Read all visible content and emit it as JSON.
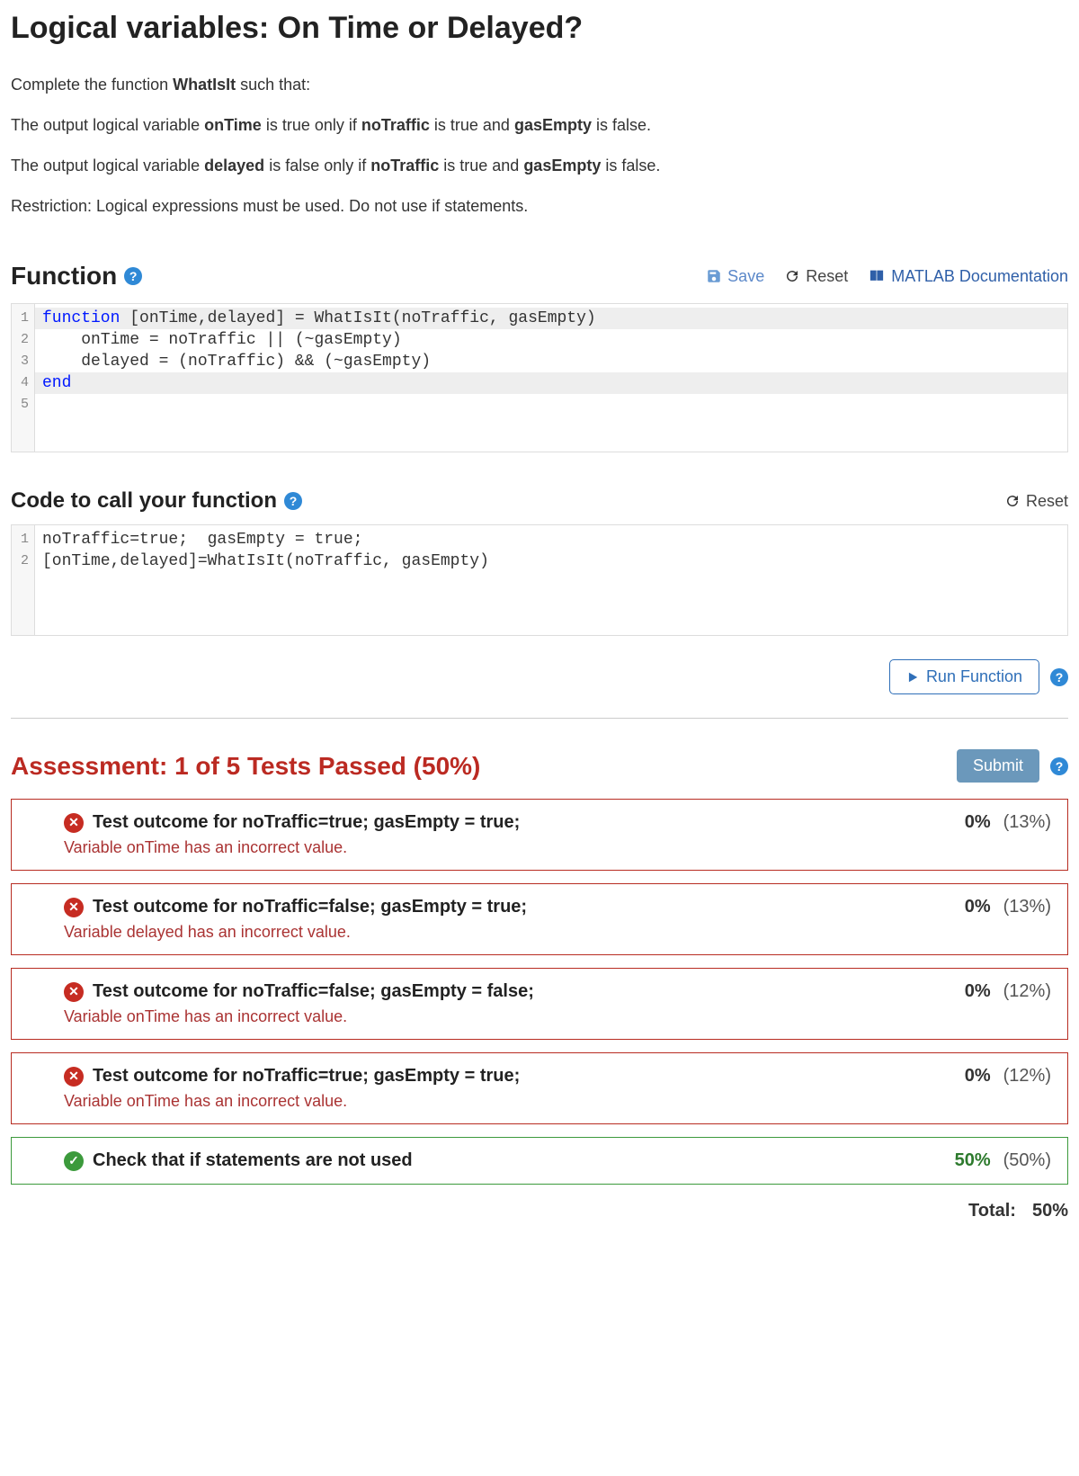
{
  "title": "Logical variables: On Time or Delayed?",
  "intro": {
    "l1_a": "Complete the function ",
    "l1_b": "WhatIsIt",
    "l1_c": " such that:",
    "l2_a": "The output logical variable ",
    "l2_b": "onTime",
    "l2_c": " is true only if ",
    "l2_d": "noTraffic",
    "l2_e": " is true and ",
    "l2_f": "gasEmpty",
    "l2_g": " is false.",
    "l3_a": "The output logical variable ",
    "l3_b": "delayed",
    "l3_c": " is false only if ",
    "l3_d": "noTraffic",
    "l3_e": " is true and ",
    "l3_f": "gasEmpty",
    "l3_g": " is false.",
    "l4": "Restriction:  Logical expressions must be used.  Do not use if statements."
  },
  "function_section": {
    "heading": "Function",
    "save": "Save",
    "reset": "Reset",
    "doc": "MATLAB Documentation"
  },
  "code1": {
    "gutter": [
      "1",
      "2",
      "3",
      "4",
      "5"
    ],
    "l1_kw": "function",
    "l1_rest": " [onTime,delayed] = WhatIsIt(noTraffic, gasEmpty)",
    "l2": "    onTime = noTraffic || (~gasEmpty)",
    "l3": "    delayed = (noTraffic) && (~gasEmpty)",
    "l4_kw": "end",
    "l5": ""
  },
  "call_section": {
    "heading": "Code to call your function",
    "reset": "Reset"
  },
  "code2": {
    "gutter": [
      "1",
      "2"
    ],
    "l1": "noTraffic=true;  gasEmpty = true;",
    "l2": "[onTime,delayed]=WhatIsIt(noTraffic, gasEmpty)"
  },
  "run_button": "Run Function",
  "assessment": {
    "heading": "Assessment: 1 of 5 Tests Passed (50%)",
    "submit": "Submit"
  },
  "tests": [
    {
      "pass": false,
      "title": "Test outcome for noTraffic=true; gasEmpty = true;",
      "msg": "Variable onTime has an incorrect value.",
      "score": "0%",
      "weight": "(13%)"
    },
    {
      "pass": false,
      "title": "Test outcome for noTraffic=false; gasEmpty = true;",
      "msg": "Variable delayed has an incorrect value.",
      "score": "0%",
      "weight": "(13%)"
    },
    {
      "pass": false,
      "title": "Test outcome for noTraffic=false; gasEmpty = false;",
      "msg": "Variable onTime has an incorrect value.",
      "score": "0%",
      "weight": "(12%)"
    },
    {
      "pass": false,
      "title": "Test outcome for noTraffic=true; gasEmpty = true;",
      "msg": "Variable onTime has an incorrect value.",
      "score": "0%",
      "weight": "(12%)"
    },
    {
      "pass": true,
      "title": "Check that if statements are not used",
      "msg": "",
      "score": "50%",
      "weight": "(50%)"
    }
  ],
  "total": {
    "label": "Total:",
    "value": "50%"
  }
}
